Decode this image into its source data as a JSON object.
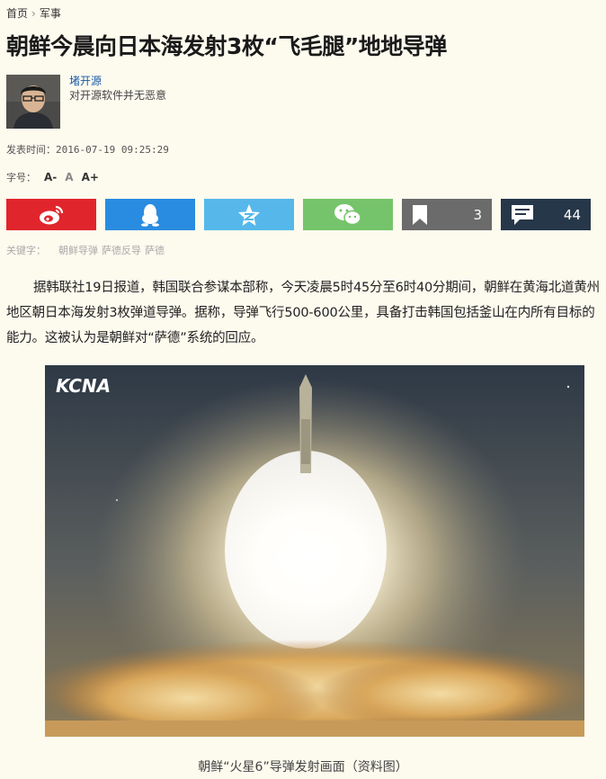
{
  "breadcrumb": {
    "home": "首页",
    "separator": "›",
    "section": "军事"
  },
  "article": {
    "title": "朝鲜今晨向日本海发射3枚“飞毛腿”地地导弹",
    "body": "据韩联社19日报道，韩国联合参谋本部称，今天凌晨5时45分至6时40分期间，朝鲜在黄海北道黄州地区朝日本海发射3枚弹道导弹。据称，导弹飞行500-600公里，具备打击韩国包括釜山在内所有目标的能力。这被认为是朝鲜对“萨德”系统的回应。"
  },
  "author": {
    "name": "堵开源",
    "signature": "对开源软件并无恶意"
  },
  "meta": {
    "published_label": "发表时间：",
    "published_time": "2016-07-19 09:25:29",
    "fontsize_label": "字号：",
    "fontsize_small": "A-",
    "fontsize_normal": "A",
    "fontsize_large": "A+"
  },
  "share": {
    "bookmark_count": "3",
    "comment_count": "44",
    "colors": {
      "weibo": "#e0262c",
      "qq": "#2a8ce0",
      "qzone": "#56b8ea",
      "wechat": "#75c46b",
      "bookmark": "#6b6b6b",
      "comment": "#27374a"
    }
  },
  "keywords": {
    "label": "关键字：",
    "items": [
      "朝鲜导弹",
      "萨德反导",
      "萨德"
    ]
  },
  "photo": {
    "watermark": "KCNA",
    "caption": "朝鲜“火星6”导弹发射画面（资料图）"
  }
}
